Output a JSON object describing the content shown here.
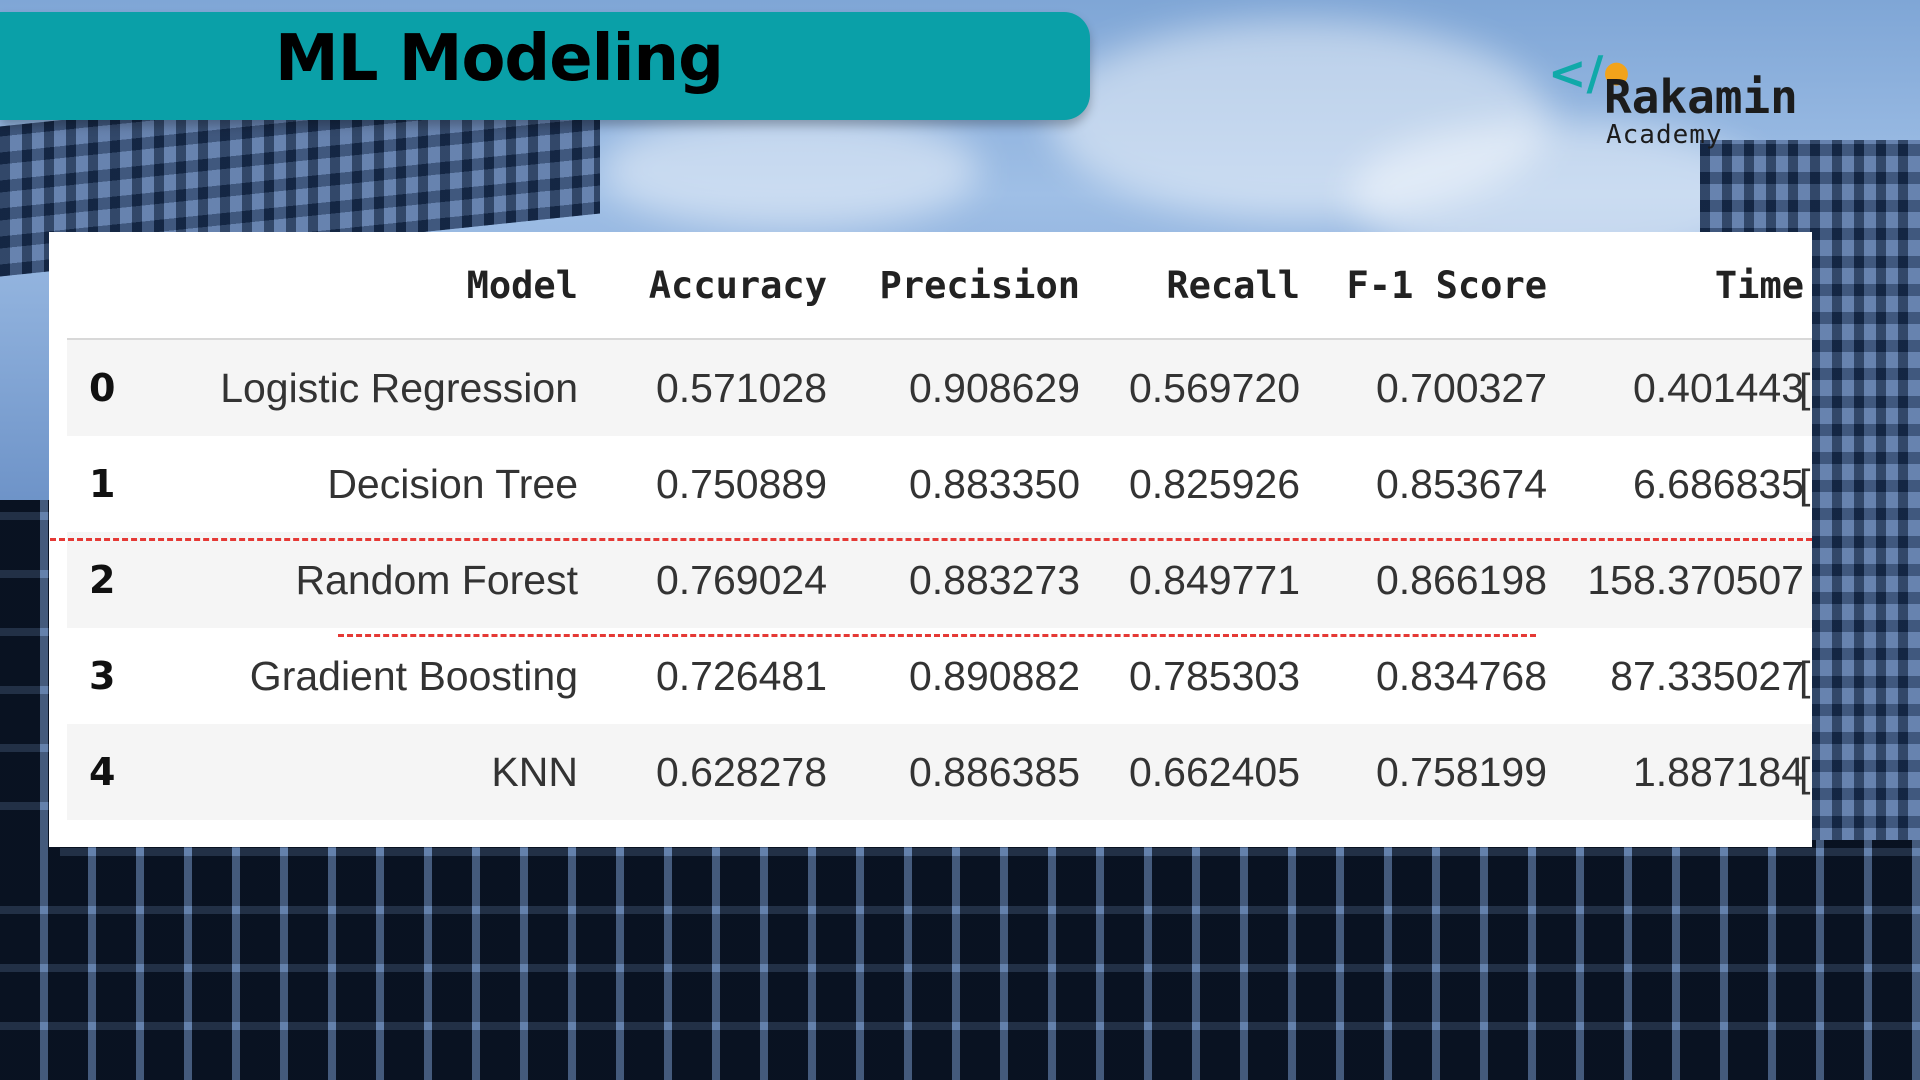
{
  "header": {
    "title": "ML Modeling"
  },
  "logo": {
    "name": "Rakamin",
    "subtitle": "Academy",
    "icon": "code-brackets-icon"
  },
  "colors": {
    "banner": "#0aa0a8",
    "highlight_dash": "#e53935",
    "logo_accent_teal": "#10a9a9",
    "logo_accent_orange": "#f2a31b"
  },
  "table": {
    "columns": [
      "Model",
      "Accuracy",
      "Precision",
      "Recall",
      "F-1 Score",
      "Time"
    ],
    "rows": [
      {
        "index": "0",
        "model": "Logistic Regression",
        "accuracy": "0.571028",
        "precision": "0.908629",
        "recall": "0.569720",
        "f1": "0.700327",
        "time": "0.401443",
        "trailing": "["
      },
      {
        "index": "1",
        "model": "Decision Tree",
        "accuracy": "0.750889",
        "precision": "0.883350",
        "recall": "0.825926",
        "f1": "0.853674",
        "time": "6.686835",
        "trailing": "["
      },
      {
        "index": "2",
        "model": "Random Forest",
        "accuracy": "0.769024",
        "precision": "0.883273",
        "recall": "0.849771",
        "f1": "0.866198",
        "time": "158.370507",
        "trailing": ""
      },
      {
        "index": "3",
        "model": "Gradient Boosting",
        "accuracy": "0.726481",
        "precision": "0.890882",
        "recall": "0.785303",
        "f1": "0.834768",
        "time": "87.335027",
        "trailing": "["
      },
      {
        "index": "4",
        "model": "KNN",
        "accuracy": "0.628278",
        "precision": "0.886385",
        "recall": "0.662405",
        "f1": "0.758199",
        "time": "1.887184",
        "trailing": "["
      }
    ]
  }
}
